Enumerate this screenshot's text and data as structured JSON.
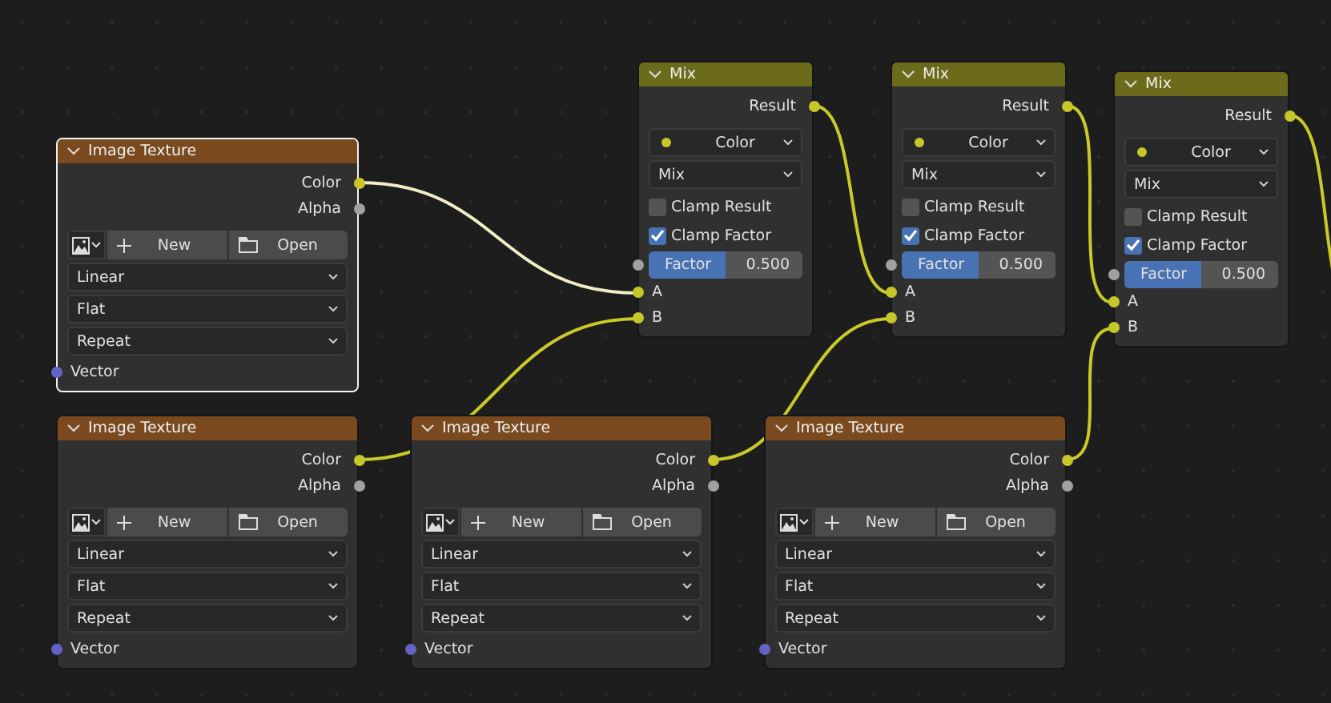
{
  "image_textures": [
    {
      "title": "Image Texture",
      "selected": true,
      "outputs": [
        "Color",
        "Alpha"
      ],
      "new_label": "New",
      "open_label": "Open",
      "interpolation": "Linear",
      "projection": "Flat",
      "extension": "Repeat",
      "input": "Vector"
    },
    {
      "title": "Image Texture",
      "selected": false,
      "outputs": [
        "Color",
        "Alpha"
      ],
      "new_label": "New",
      "open_label": "Open",
      "interpolation": "Linear",
      "projection": "Flat",
      "extension": "Repeat",
      "input": "Vector"
    },
    {
      "title": "Image Texture",
      "selected": false,
      "outputs": [
        "Color",
        "Alpha"
      ],
      "new_label": "New",
      "open_label": "Open",
      "interpolation": "Linear",
      "projection": "Flat",
      "extension": "Repeat",
      "input": "Vector"
    },
    {
      "title": "Image Texture",
      "selected": false,
      "outputs": [
        "Color",
        "Alpha"
      ],
      "new_label": "New",
      "open_label": "Open",
      "interpolation": "Linear",
      "projection": "Flat",
      "extension": "Repeat",
      "input": "Vector"
    }
  ],
  "mix_nodes": [
    {
      "title": "Mix",
      "selected": false,
      "output": "Result",
      "data_type": "Color",
      "blend_type": "Mix",
      "clamp_result": {
        "label": "Clamp Result",
        "checked": false
      },
      "clamp_factor": {
        "label": "Clamp Factor",
        "checked": true
      },
      "factor": {
        "label": "Factor",
        "value": "0.500",
        "level": 0.5
      },
      "inputs": [
        "A",
        "B"
      ]
    },
    {
      "title": "Mix",
      "selected": false,
      "output": "Result",
      "data_type": "Color",
      "blend_type": "Mix",
      "clamp_result": {
        "label": "Clamp Result",
        "checked": false
      },
      "clamp_factor": {
        "label": "Clamp Factor",
        "checked": true
      },
      "factor": {
        "label": "Factor",
        "value": "0.500",
        "level": 0.5
      },
      "inputs": [
        "A",
        "B"
      ]
    },
    {
      "title": "Mix",
      "selected": false,
      "output": "Result",
      "data_type": "Color",
      "blend_type": "Mix",
      "clamp_result": {
        "label": "Clamp Result",
        "checked": false
      },
      "clamp_factor": {
        "label": "Clamp Factor",
        "checked": true
      },
      "factor": {
        "label": "Factor",
        "value": "0.500",
        "level": 0.5
      },
      "inputs": [
        "A",
        "B"
      ]
    }
  ],
  "links": [
    {
      "selected": true
    },
    {
      "selected": false
    },
    {
      "selected": false
    },
    {
      "selected": false
    },
    {
      "selected": false
    },
    {
      "selected": false
    },
    {
      "selected": false
    }
  ]
}
